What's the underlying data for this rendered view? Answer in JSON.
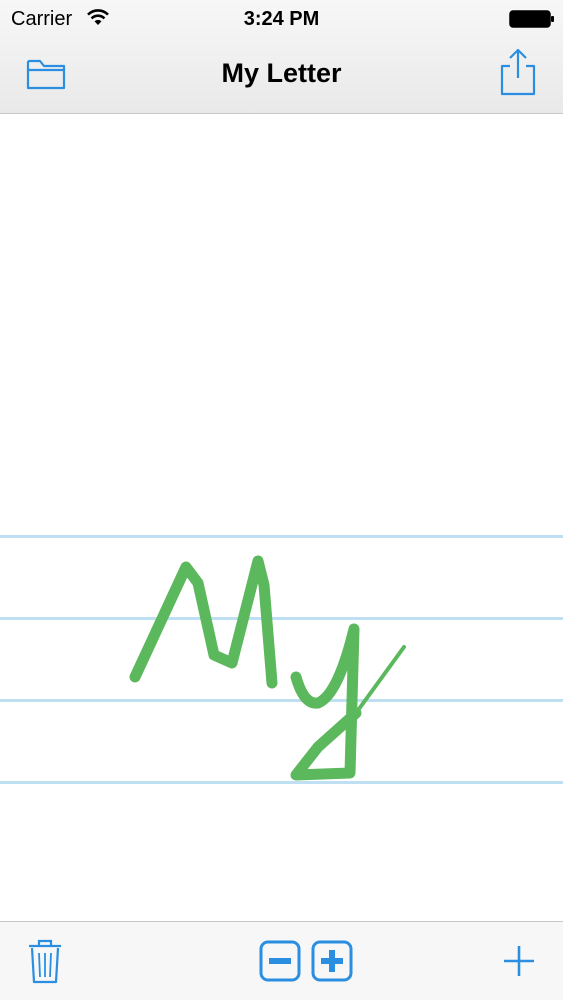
{
  "status_bar": {
    "carrier": "Carrier",
    "time": "3:24 PM"
  },
  "nav_bar": {
    "title": "My Letter",
    "left_icon": "folder-icon",
    "right_icon": "share-icon"
  },
  "canvas": {
    "ruled_line_count": 4,
    "ink_color": "#5cb85c",
    "line_color": "#bfdff2"
  },
  "toolbar": {
    "left_icon": "trash-icon",
    "center_icons": [
      "zoom-out-icon",
      "zoom-in-icon"
    ],
    "right_icon": "plus-icon"
  },
  "colors": {
    "accent": "#2a8fe0",
    "chrome_background": "#f7f7f7"
  }
}
